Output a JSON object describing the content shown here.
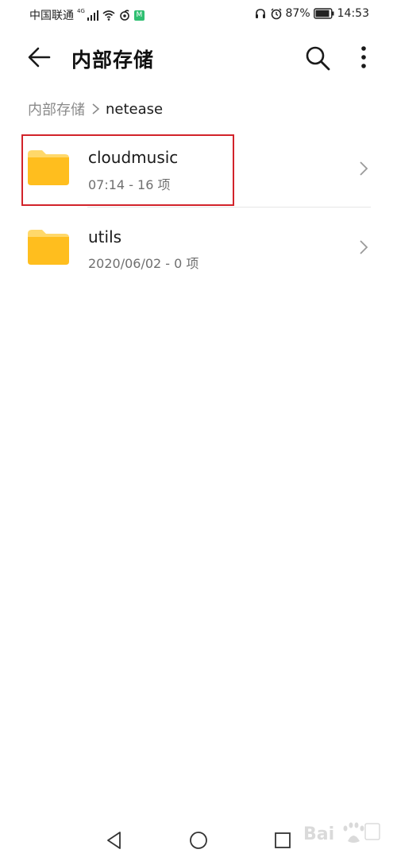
{
  "status_bar": {
    "carrier": "中国联通",
    "network": "4G",
    "battery": "87%",
    "time": "14:53",
    "mi_badge": "M"
  },
  "app_bar": {
    "title": "内部存储",
    "icons": [
      "back-arrow-icon",
      "search-icon",
      "more-vert-icon"
    ]
  },
  "breadcrumb": {
    "root": "内部存储",
    "current": "netease"
  },
  "folders": [
    {
      "name": "cloudmusic",
      "meta": "07:14 - 16 项"
    },
    {
      "name": "utils",
      "meta": "2020/06/02 - 0 项"
    }
  ],
  "colors": {
    "folder": "#ffbe1e",
    "folder_tab": "#ffd86a",
    "highlight": "#d2232a"
  }
}
